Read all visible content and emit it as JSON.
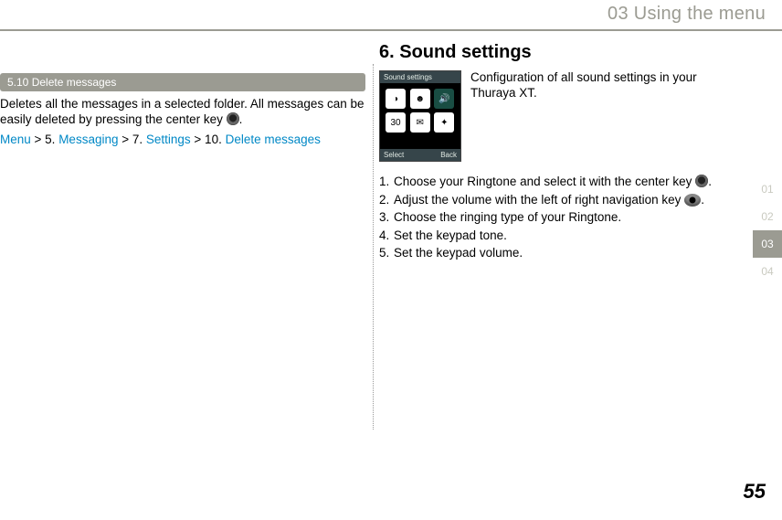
{
  "header": {
    "title": "03 Using the menu"
  },
  "left": {
    "section_label": "5.10  Delete messages",
    "body_line1": "Deletes all the messages in a selected folder. All messages can be easily deleted by pressing the center key ",
    "body_dot": ".",
    "crumb": {
      "menu": "Menu",
      "gt1": " > 5. ",
      "messaging": "Messaging",
      "gt2": "  > 7. ",
      "settings": "Settings",
      "gt3": " > 10. ",
      "delete": "Delete messages"
    }
  },
  "right": {
    "heading": "6. Sound settings",
    "phone_title": "Sound settings",
    "soft_left": "Select",
    "soft_right": "Back",
    "config_text": "Configuration of all sound settings in your Thuraya XT.",
    "steps": {
      "s1a": "Choose your Ringtone and select it with the center key ",
      "s1b": ".",
      "s2a": "Adjust the volume with the left of right navigation key ",
      "s2b": ".",
      "s3": "Choose the ringing type of your Ringtone.",
      "s4": "Set the keypad tone.",
      "s5": "Set the keypad volume."
    }
  },
  "side_tabs": [
    "01",
    "02",
    "03",
    "04"
  ],
  "page_number": "55"
}
